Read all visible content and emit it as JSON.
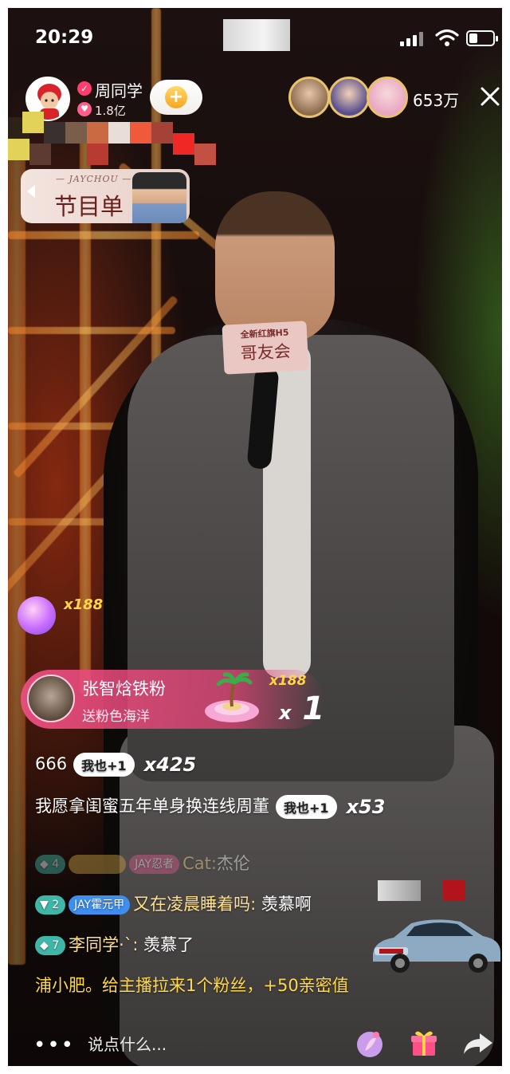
{
  "status_bar": {
    "time": "20:29",
    "battery_level": 0.35
  },
  "host": {
    "name": "周同学",
    "likes": "1.8亿",
    "follow_label": "+"
  },
  "viewers": {
    "count": "653万"
  },
  "program_card": {
    "subtitle": "— JAYCHOU —",
    "title": "节目单"
  },
  "stage": {
    "mic_card_line1": "全新红旗H5",
    "mic_card_line2": "哥友会"
  },
  "gift_effects": {
    "small_gift_count": "x188",
    "main": {
      "user": "张智焓铁粉",
      "description": "送粉色海洋",
      "count_top": "x188",
      "multiplier_x": "x",
      "multiplier_num": "1"
    }
  },
  "chat": [
    {
      "text": "666",
      "metoo": "我也+1",
      "combo": "x425"
    },
    {
      "text": "我愿拿闺蜜五年单身换连线周董",
      "metoo": "我也+1",
      "combo": "x53"
    },
    {
      "level": "4",
      "fan_badge": "JAY忍者",
      "name": "Cat:",
      "message": "杰伦"
    },
    {
      "level": "2",
      "fan_badge": "JAY霍元甲",
      "name": "又在凌晨睡着吗:",
      "message": "羡慕啊"
    },
    {
      "level": "7",
      "name": "李同学·`:",
      "message": "羡慕了"
    },
    {
      "text": "浦小肥。给主播拉来1个粉丝，+50亲密值"
    }
  ],
  "bottom_bar": {
    "more_label": "•••",
    "comment_placeholder": "说点什么..."
  },
  "colors": {
    "accent_pink": "#ec4e80",
    "combo_gold": "#ffd64a",
    "level_teal": "#3fb7a8",
    "fan_blue": "#3e8ef0"
  },
  "icons": [
    "signal-icon",
    "wifi-icon",
    "battery-icon",
    "close-icon",
    "gift-icon",
    "share-icon",
    "potion-icon",
    "car-icon"
  ]
}
